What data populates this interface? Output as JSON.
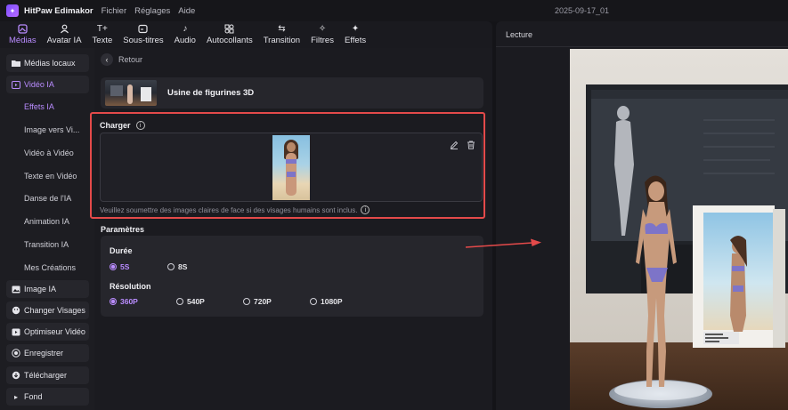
{
  "titlebar": {
    "app_name": "HitPaw Edimakor",
    "menu": [
      "Fichier",
      "Réglages",
      "Aide"
    ],
    "document_name": "2025-09-17_01"
  },
  "toolbar": {
    "items": [
      {
        "label": "Médias",
        "icon": "media-icon",
        "active": true
      },
      {
        "label": "Avatar IA",
        "icon": "avatar-icon"
      },
      {
        "label": "Texte",
        "icon": "text-icon"
      },
      {
        "label": "Sous-titres",
        "icon": "subtitles-icon"
      },
      {
        "label": "Audio",
        "icon": "audio-icon"
      },
      {
        "label": "Autocollants",
        "icon": "stickers-icon"
      },
      {
        "label": "Transition",
        "icon": "transition-icon"
      },
      {
        "label": "Filtres",
        "icon": "filters-icon"
      },
      {
        "label": "Effets",
        "icon": "effects-icon"
      }
    ]
  },
  "sidebar": {
    "items": [
      {
        "label": "Médias locaux",
        "icon": "folder-icon"
      },
      {
        "label": "Vidéo IA",
        "icon": "ai-video-icon"
      },
      {
        "label": "Image IA",
        "icon": "image-icon"
      },
      {
        "label": "Changer Visages",
        "icon": "face-swap-icon"
      },
      {
        "label": "Optimiseur Vidéo",
        "icon": "enhance-icon"
      },
      {
        "label": "Enregistrer",
        "icon": "record-icon"
      },
      {
        "label": "Télécharger",
        "icon": "download-icon"
      },
      {
        "label": "Fond",
        "icon": "chevron-right-icon"
      }
    ],
    "sub_items": [
      "Effets IA",
      "Image vers Vi...",
      "Vidéo à Vidéo",
      "Texte en Vidéo",
      "Danse de l'IA",
      "Animation IA",
      "Transition IA",
      "Mes Créations"
    ]
  },
  "main": {
    "back_label": "Retour",
    "effect_title": "Usine de figurines 3D",
    "upload": {
      "label": "Charger",
      "hint": "Veuillez soumettre des images claires de face si des visages humains sont inclus."
    },
    "params_title": "Paramètres",
    "duration": {
      "label": "Durée",
      "options": [
        "5S",
        "8S"
      ],
      "selected": "5S"
    },
    "resolution": {
      "label": "Résolution",
      "options": [
        "360P",
        "540P",
        "720P",
        "1080P"
      ],
      "selected": "360P"
    }
  },
  "preview": {
    "title": "Lecture"
  },
  "colors": {
    "accent": "#b98cff",
    "highlight_box": "#e44a4a"
  }
}
